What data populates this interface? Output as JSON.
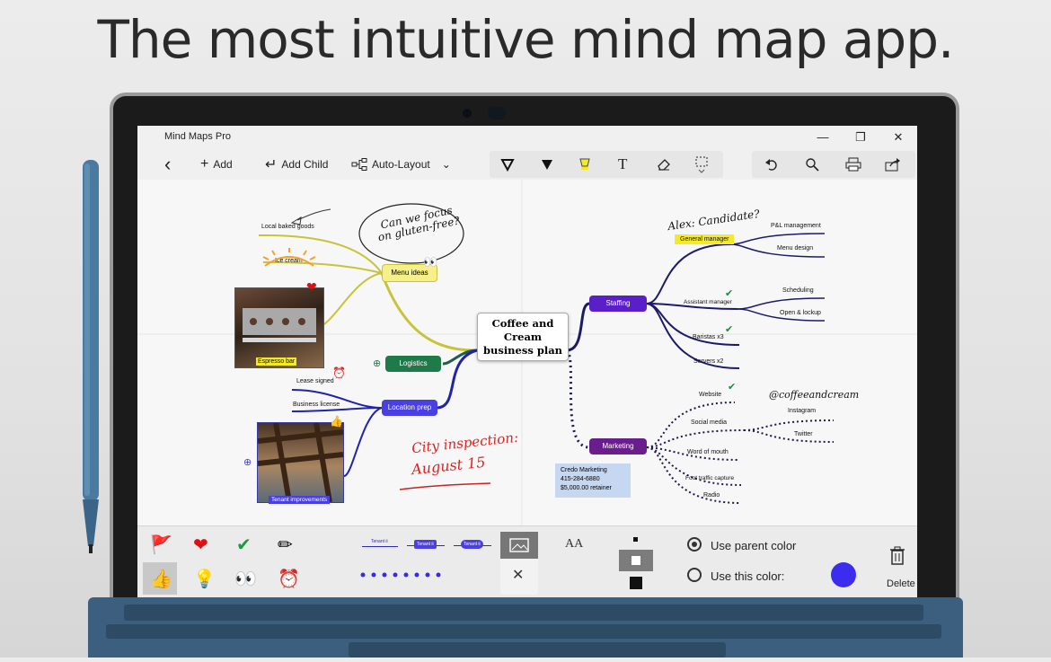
{
  "headline": "The most intuitive mind map app.",
  "window": {
    "title": "Mind Maps Pro",
    "minimize": "—",
    "restore": "❐",
    "close": "✕"
  },
  "toolbar": {
    "back": "‹",
    "add": "Add",
    "add_child": "Add Child",
    "auto_layout": "Auto-Layout",
    "text_tool": "T"
  },
  "map": {
    "central": "Coffee and Cream business plan",
    "branches": {
      "menu_ideas": "Menu ideas",
      "logistics": "Logistics",
      "location_prep": "Location prep",
      "staffing": "Staffing",
      "marketing": "Marketing"
    },
    "leaves": {
      "local_baked_goods": "Local baked goods",
      "ice_cream": "Ice cream",
      "espresso_bar": "Espresso bar",
      "lease_signed": "Lease signed",
      "business_license": "Business license",
      "tenant_improvements": "Tenant improvements",
      "general_manager": "General manager",
      "pl_management": "P&L management",
      "menu_design": "Menu design",
      "assistant_manager": "Assistant manager",
      "scheduling": "Scheduling",
      "open_lockup": "Open & lockup",
      "baristas": "Baristas x3",
      "servers": "Servers x2",
      "website": "Website",
      "social_media": "Social media",
      "instagram": "Instagram",
      "twitter": "Twitter",
      "word_of_mouth": "Word of mouth",
      "foot_traffic": "Foot traffic capture",
      "radio": "Radio"
    },
    "note": {
      "line1": "Credo Marketing",
      "line2": "415-284-6880",
      "line3": "$5,000.00 retainer"
    },
    "ink": {
      "gluten": "Can we focus on gluten-free?",
      "candidate": "Alex: Candidate?",
      "inspection1": "City inspection:",
      "inspection2": "August 15",
      "handle": "@coffeeandcream"
    }
  },
  "bottom_bar": {
    "line_sample_1": "Tenant ii",
    "line_sample_2": "Tenant ii",
    "line_sample_3": "Tenant ii",
    "use_parent_color": "Use parent color",
    "use_this_color": "Use this color:",
    "delete": "Delete",
    "font_size_icon": "AA"
  },
  "colors": {
    "accent_purple": "#5b1fd1",
    "staffing_purple": "#5a1fc8",
    "marketing_purple": "#6a1d8c",
    "logistics_green": "#1f7a4a",
    "location_blue": "#4a3fe0",
    "menu_yellow": "#f6ef8a",
    "highlight_yellow": "#f4ea2a",
    "selected_color": "#3b2cf0"
  }
}
